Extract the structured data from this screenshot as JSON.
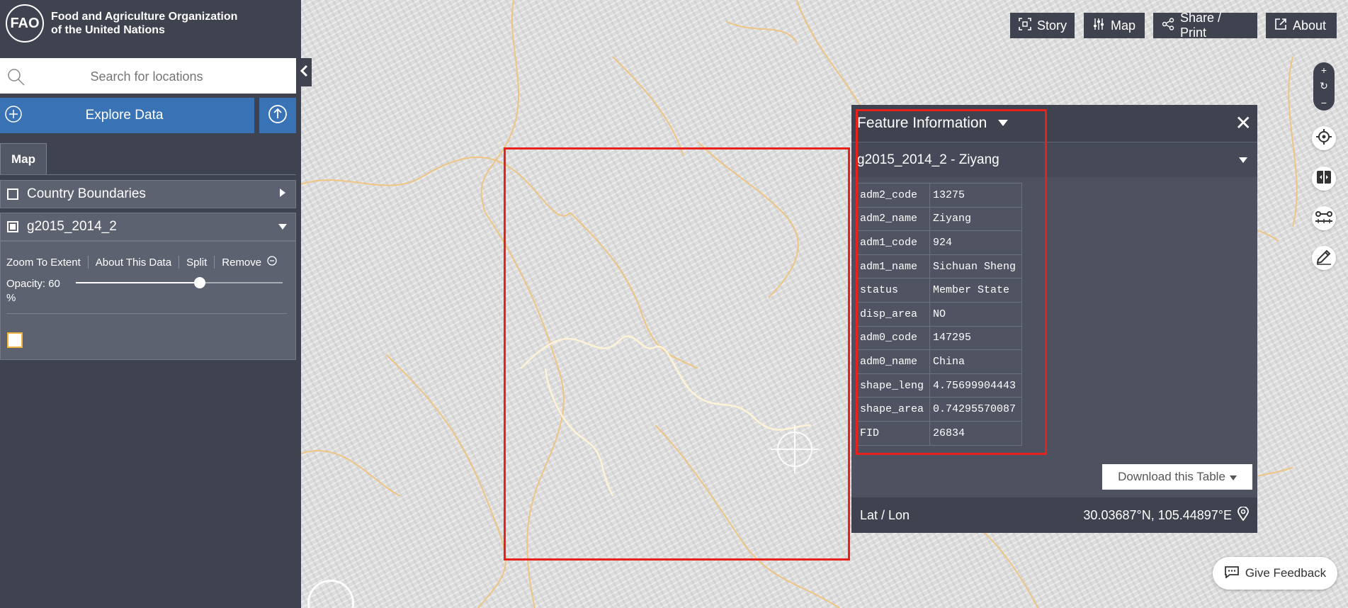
{
  "header": {
    "org_name_line1": "Food and Agriculture Organization",
    "org_name_line2": "of the United Nations",
    "logo_text": "FAO"
  },
  "search": {
    "placeholder": "Search for locations"
  },
  "explore": {
    "label": "Explore Data"
  },
  "tabs": [
    {
      "label": "Map"
    }
  ],
  "layers": [
    {
      "label": "Country Boundaries",
      "checked": false
    },
    {
      "label": "g2015_2014_2",
      "checked": true
    }
  ],
  "layer_actions": {
    "zoom": "Zoom To Extent",
    "about": "About This Data",
    "split": "Split",
    "remove": "Remove"
  },
  "opacity": {
    "label": "Opacity: 60 %",
    "value": 60
  },
  "toolbar": {
    "story": "Story",
    "map": "Map",
    "share": "Share / Print",
    "about": "About"
  },
  "feature_panel": {
    "title": "Feature Information",
    "selected_feature": "g2015_2014_2 - Ziyang",
    "attributes": [
      {
        "key": "adm2_code",
        "value": "13275"
      },
      {
        "key": "adm2_name",
        "value": "Ziyang"
      },
      {
        "key": "adm1_code",
        "value": "924"
      },
      {
        "key": "adm1_name",
        "value": "Sichuan Sheng"
      },
      {
        "key": "status",
        "value": "Member State"
      },
      {
        "key": "disp_area",
        "value": "NO"
      },
      {
        "key": "adm0_code",
        "value": "147295"
      },
      {
        "key": "adm0_name",
        "value": "China"
      },
      {
        "key": "shape_leng",
        "value": "4.75699904443"
      },
      {
        "key": "shape_area",
        "value": "0.74295570087"
      },
      {
        "key": "FID",
        "value": "26834"
      }
    ],
    "download_label": "Download this Table",
    "latlon_label": "Lat / Lon",
    "latlon_value": "30.03687°N, 105.44897°E"
  },
  "feedback": {
    "label": "Give Feedback"
  },
  "colors": {
    "accent": "#3a73b5",
    "panel": "#3f4350",
    "highlight": "#e8211d",
    "boundary": "#f0b43d"
  },
  "icons": [
    "search-icon",
    "chevron-left-icon",
    "plus-circle-icon",
    "upload-icon",
    "story-icon",
    "sliders-icon",
    "share-icon",
    "external-link-icon",
    "close-icon",
    "caret-down-icon",
    "crosshair-icon",
    "split-icon",
    "measure-icon",
    "pencil-icon",
    "location-pin-icon",
    "chat-icon"
  ]
}
